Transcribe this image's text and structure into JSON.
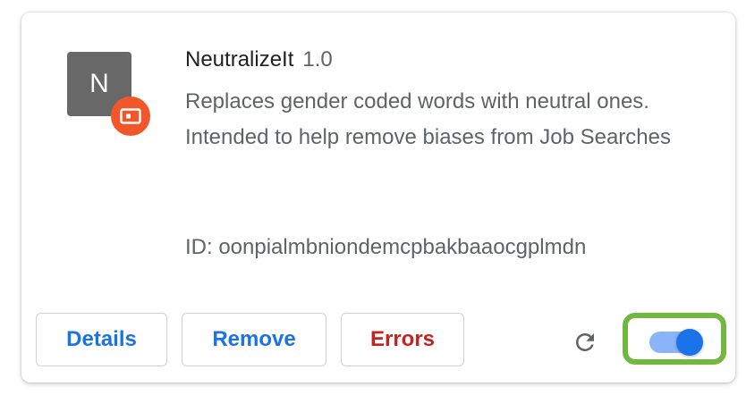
{
  "extension": {
    "icon_letter": "N",
    "badge_icon": "unpacked-extension-icon",
    "name": "NeutralizeIt",
    "version": "1.0",
    "description": "Replaces gender coded words with neutral ones. Intended to help remove biases from Job Searches",
    "id_text": "ID: oonpialmbniondemcpbakbaaocgplmdn"
  },
  "actions": {
    "details_label": "Details",
    "remove_label": "Remove",
    "errors_label": "Errors",
    "reload_icon": "reload-icon"
  },
  "toggle": {
    "enabled": true,
    "highlighted": true
  },
  "colors": {
    "accent_blue": "#1a73e8",
    "error_red": "#c5221f",
    "badge_orange": "#f1572a",
    "highlight_green": "#72b840",
    "toggle_track": "#8ab4f8"
  }
}
